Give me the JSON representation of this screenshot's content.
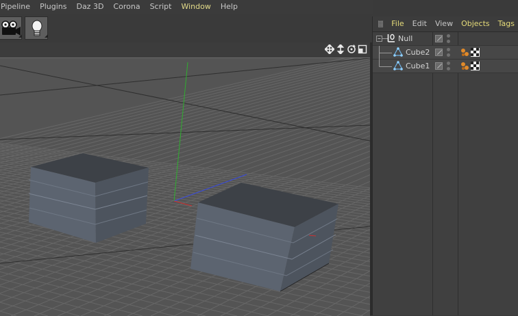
{
  "menubar": {
    "items": [
      "Pipeline",
      "Plugins",
      "Daz 3D",
      "Corona",
      "Script",
      "Window",
      "Help"
    ],
    "active_index": 5
  },
  "toolbar": {
    "buttons": [
      {
        "icon": "camera-icon"
      },
      {
        "icon": "light-bulb-icon"
      }
    ]
  },
  "viewport": {
    "nav_icons": [
      "move-view-icon",
      "dolly-view-icon",
      "rotate-view-icon",
      "maximize-view-icon"
    ],
    "objects": [
      "Cube2",
      "Cube1"
    ],
    "axis_colors": {
      "x": "#d03030",
      "y": "#30b030",
      "z": "#3050e0"
    },
    "background": "#545454"
  },
  "object_manager": {
    "menu": [
      {
        "label": "File",
        "highlight": true
      },
      {
        "label": "Edit",
        "highlight": false
      },
      {
        "label": "View",
        "highlight": false
      },
      {
        "label": "Objects",
        "highlight": true
      },
      {
        "label": "Tags",
        "highlight": true
      }
    ],
    "rows": [
      {
        "name": "Null",
        "icon": "null-object-icon",
        "depth": 0,
        "expanded": true,
        "tags": []
      },
      {
        "name": "Cube2",
        "icon": "polygon-object-icon",
        "depth": 1,
        "tags": [
          "phong-tag-icon",
          "material-tag-icon"
        ]
      },
      {
        "name": "Cube1",
        "icon": "polygon-object-icon",
        "depth": 1,
        "tags": [
          "phong-tag-icon",
          "material-tag-icon"
        ]
      }
    ]
  }
}
